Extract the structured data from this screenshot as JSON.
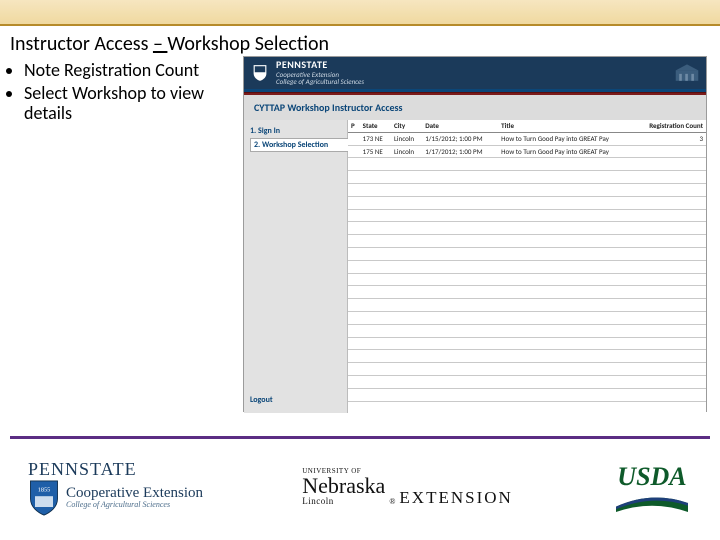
{
  "title_parts": {
    "a": "Instructor Access ",
    "dash": "– ",
    "b": "Workshop Selection"
  },
  "bullets": [
    "Note Registration Count",
    "Select Workshop to view details"
  ],
  "banner": {
    "brand": "PENNSTATE",
    "coop": "Cooperative Extension",
    "college": "College of Agricultural Sciences"
  },
  "cyttap_heading": "CYTTAP Workshop Instructor Access",
  "steps": [
    "1. Sign In",
    "2. Workshop Selection"
  ],
  "logout": "Logout",
  "columns": {
    "p": "P",
    "state": "State",
    "city": "City",
    "date": "Date",
    "title": "Title",
    "reg": "Registration Count"
  },
  "rows": [
    {
      "p": "",
      "state": "173 NE",
      "city": "Lincoln",
      "date": "1/15/2012; 1:00 PM",
      "title": "How to Turn Good Pay into GREAT Pay",
      "reg": "3"
    },
    {
      "p": "",
      "state": "175 NE",
      "city": "Lincoln",
      "date": "1/17/2012; 1:00 PM",
      "title": "How to Turn Good Pay into GREAT Pay",
      "reg": ""
    }
  ],
  "logos": {
    "pennstate": {
      "word": "PENNSTATE",
      "year": "1855",
      "coop": "Cooperative Extension",
      "college": "College of Agricultural Sciences"
    },
    "nebraska": {
      "uo": "UNIVERSITY OF",
      "nb": "Nebraska",
      "ln": "Lincoln",
      "ext": "EXTENSION"
    },
    "usda": {
      "word": "USDA"
    }
  }
}
